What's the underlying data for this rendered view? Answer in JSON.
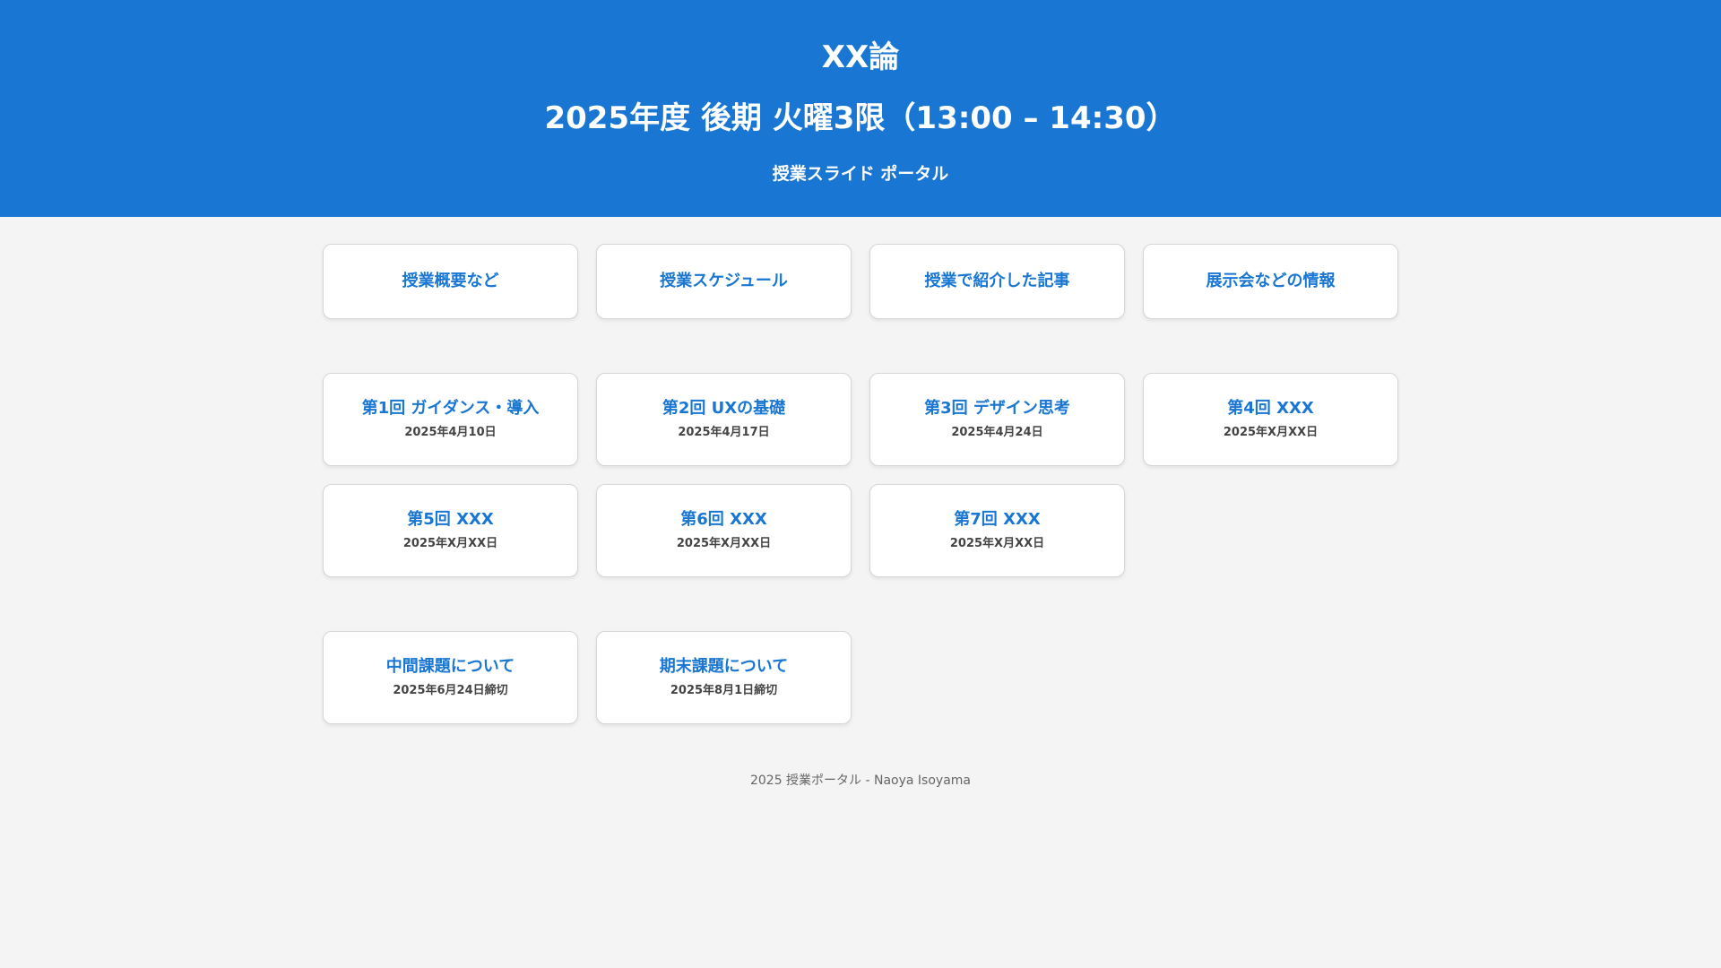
{
  "header": {
    "course_title": "XX論",
    "term": "2025年度 後期 火曜3限（13:00 – 14:30）",
    "portal_label": "授業スライド ポータル"
  },
  "nav": [
    {
      "label": "授業概要など"
    },
    {
      "label": "授業スケジュール"
    },
    {
      "label": "授業で紹介した記事"
    },
    {
      "label": "展示会などの情報"
    }
  ],
  "lectures": [
    {
      "title": "第1回 ガイダンス・導入",
      "date": "2025年4月10日"
    },
    {
      "title": "第2回 UXの基礎",
      "date": "2025年4月17日"
    },
    {
      "title": "第3回 デザイン思考",
      "date": "2025年4月24日"
    },
    {
      "title": "第4回 XXX",
      "date": "2025年X月XX日"
    },
    {
      "title": "第5回 XXX",
      "date": "2025年X月XX日"
    },
    {
      "title": "第6回 XXX",
      "date": "2025年X月XX日"
    },
    {
      "title": "第7回 XXX",
      "date": "2025年X月XX日"
    }
  ],
  "assignments": [
    {
      "title": "中間課題について",
      "deadline": "2025年6月24日締切"
    },
    {
      "title": "期末課題について",
      "deadline": "2025年8月1日締切"
    }
  ],
  "footer": {
    "text": "2025 授業ポータル - Naoya Isoyama"
  },
  "colors": {
    "header_bg": "#1976d2",
    "accent": "#1976d2",
    "page_bg": "#f4f4f4"
  }
}
